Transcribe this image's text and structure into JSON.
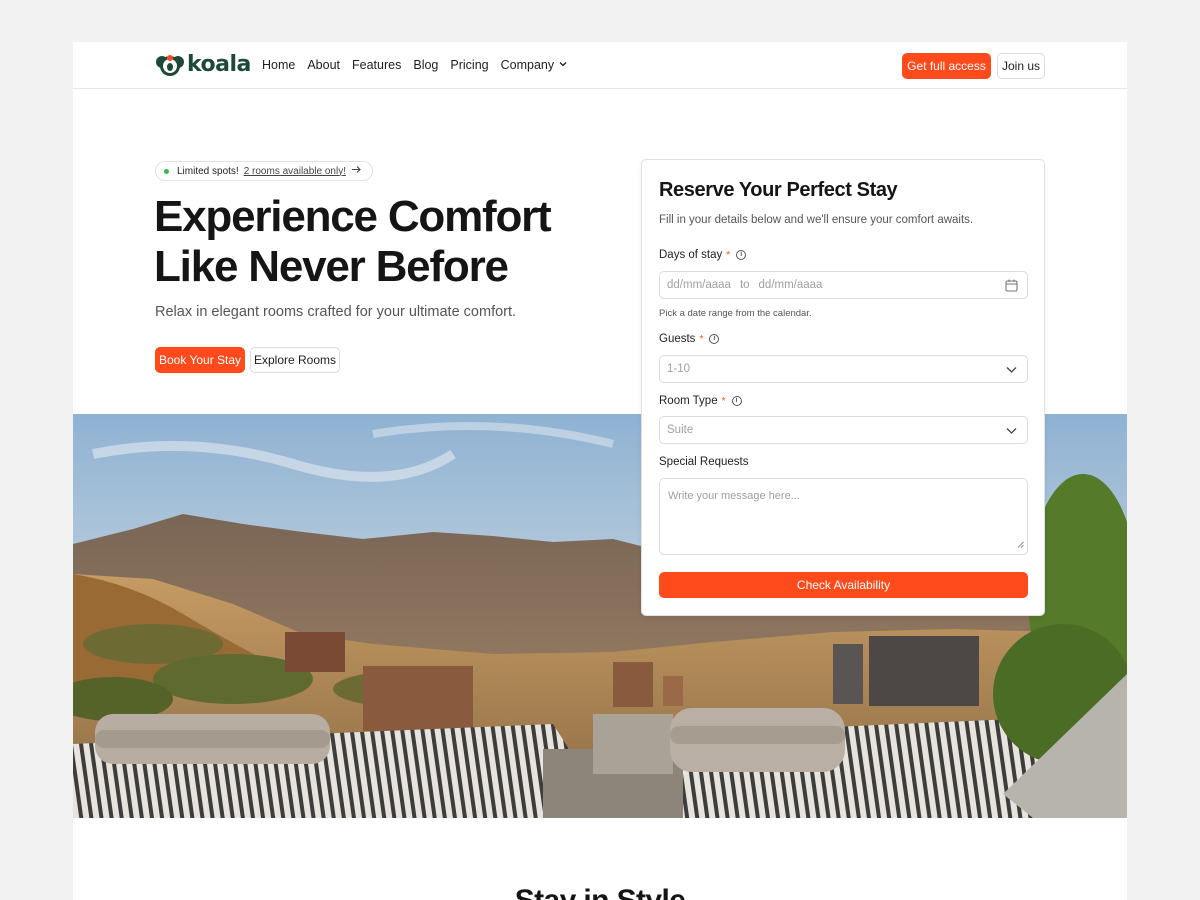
{
  "nav": {
    "logo_text": "koala",
    "links": [
      "Home",
      "About",
      "Features",
      "Blog",
      "Pricing"
    ],
    "dropdown_label": "Company",
    "cta_primary": "Get full access",
    "cta_secondary": "Join us"
  },
  "hero": {
    "badge_label": "Limited spots!",
    "badge_link": "2 rooms available only!",
    "headline": "Experience Comfort Like Never Before",
    "subhead": "Relax in elegant rooms crafted for your ultimate comfort.",
    "primary_button": "Book Your Stay",
    "secondary_button": "Explore Rooms"
  },
  "form": {
    "title": "Reserve Your Perfect Stay",
    "subtitle": "Fill in your details below and we'll ensure your comfort awaits.",
    "days": {
      "label": "Days of stay",
      "required_mark": "*",
      "start_placeholder": "dd/mm/aaaa",
      "separator": "to",
      "end_placeholder": "dd/mm/aaaa",
      "hint": "Pick a date range from the calendar."
    },
    "guests": {
      "label": "Guests",
      "required_mark": "*",
      "value": "1-10"
    },
    "room_type": {
      "label": "Room Type",
      "required_mark": "*",
      "value": "Suite"
    },
    "requests": {
      "label": "Special Requests",
      "placeholder": "Write your message here..."
    },
    "submit": "Check Availability"
  },
  "bottom": {
    "heading": "Stay in Style"
  },
  "colors": {
    "accent": "#ff4a1c",
    "brand": "#1d4a36",
    "badge_dot": "#3bb54a"
  },
  "icons": {
    "logo": "koala-logo-icon",
    "dropdown": "chevron-down-icon",
    "badge_arrow": "arrow-right-icon",
    "info": "info-icon",
    "calendar": "calendar-icon",
    "select": "chevron-down-icon",
    "resize": "resize-handle-icon"
  }
}
